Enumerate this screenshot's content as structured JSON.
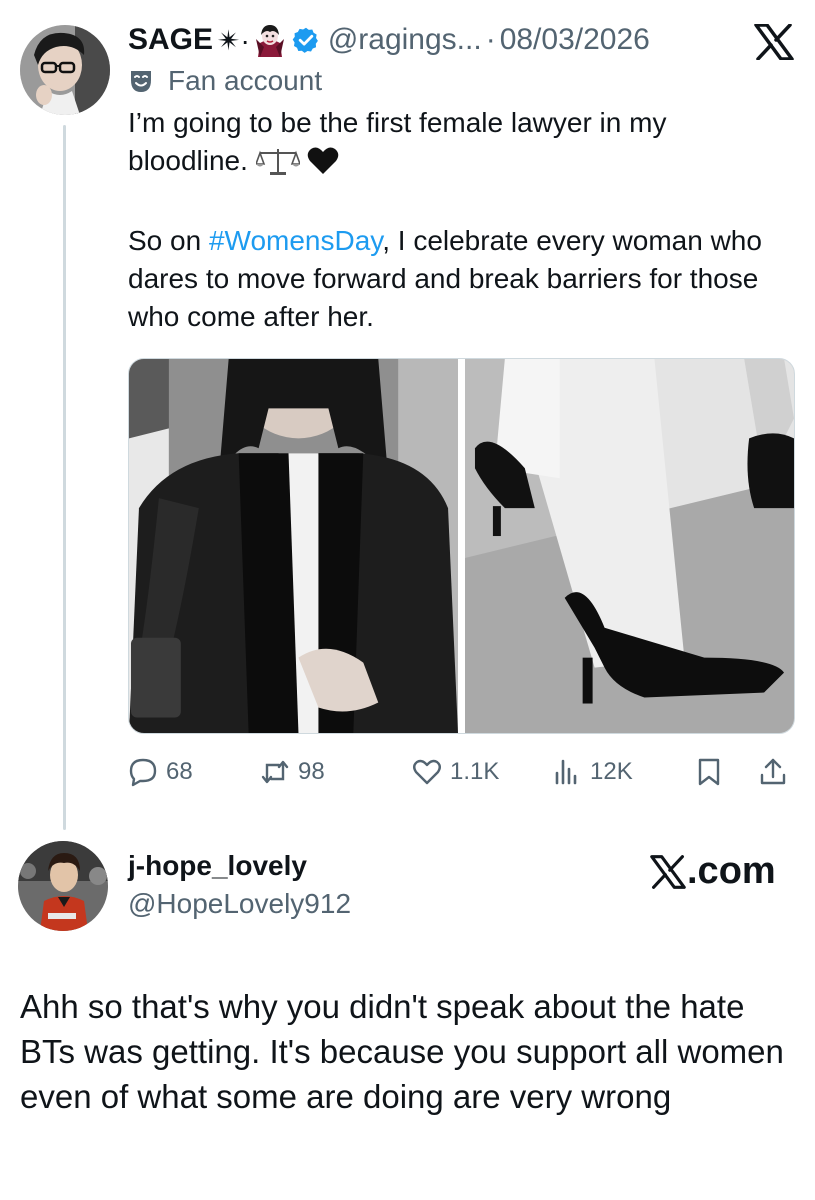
{
  "tweet": {
    "display_name": "SAGE",
    "name_decoration": "✴·",
    "handle": "@ragings...",
    "separator": "·",
    "date": "08/03/2026",
    "label": "Fan account",
    "text_line1": "I’m going to be the first female lawyer in my bloodline.",
    "text_pre_hashtag": "So on ",
    "hashtag": "#WomensDay",
    "text_post_hashtag": ", I celebrate every woman who dares to move forward and break barriers for those who come after her.",
    "stats": {
      "replies": "68",
      "reposts": "98",
      "likes": "1.1K",
      "views": "12K"
    },
    "media": [
      {
        "icon": "photo-blazer-scarf"
      },
      {
        "icon": "photo-black-heels"
      }
    ]
  },
  "reply": {
    "display_name": "j-hope_lovely",
    "handle": "@HopeLovely912",
    "site_logo_text": ".com",
    "text": "Ahh so that's why you didn't speak about the hate BTs was getting. It's because you support all women even of what some are doing are very wrong"
  },
  "colors": {
    "text": "#0f1419",
    "secondary": "#536471",
    "link": "#1d9bf0",
    "verified": "#1d9bf0",
    "thread_line": "#cfd9de"
  },
  "icons": {
    "verified": "verified-badge-icon",
    "fan": "theater-mask-icon",
    "brand": "x-logo-icon",
    "scales": "scales-icon",
    "heart": "black-heart-icon",
    "vampire": "vampire-emoji-icon"
  }
}
